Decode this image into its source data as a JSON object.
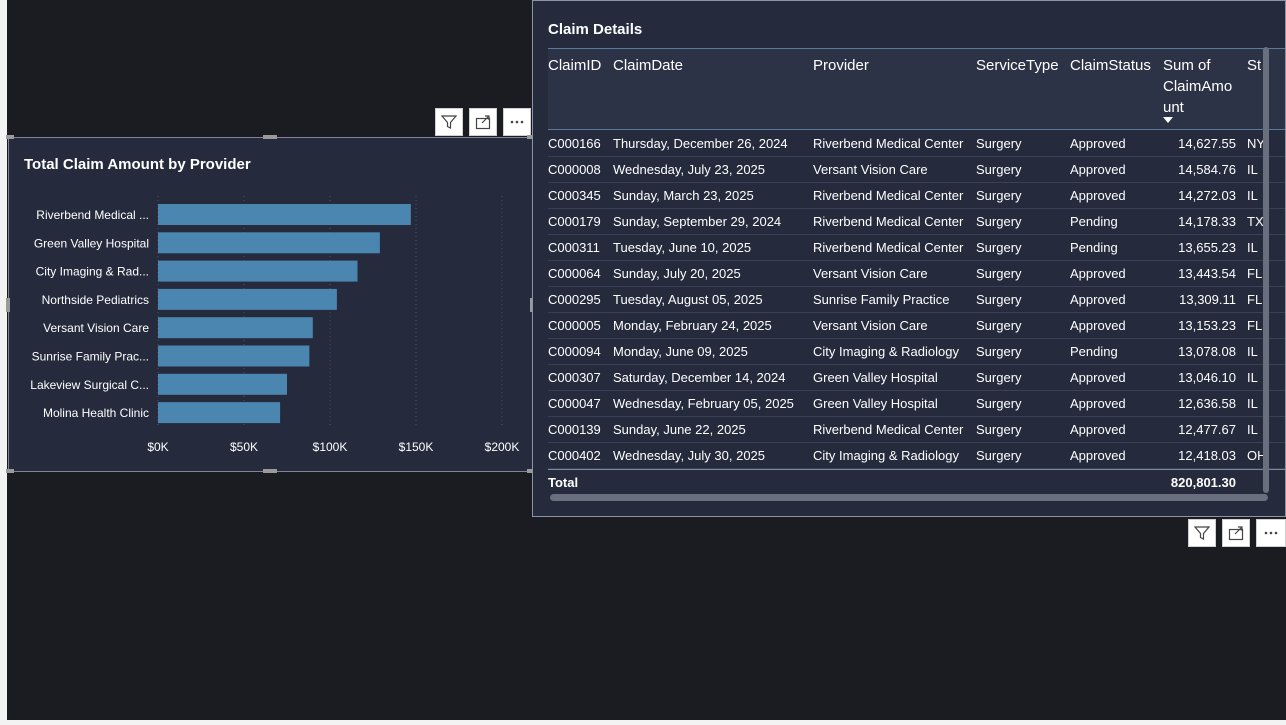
{
  "chart_visual": {
    "title": "Total Claim Amount by Provider",
    "buttons": [
      {
        "name": "filter-icon",
        "glyph": "⛉"
      },
      {
        "name": "focus-mode-icon",
        "glyph": "⤢"
      },
      {
        "name": "more-options-icon",
        "glyph": "⋯"
      }
    ]
  },
  "chart_data": {
    "type": "bar",
    "orientation": "horizontal",
    "title": "Total Claim Amount by Provider",
    "categories": [
      "Riverbend Medical ...",
      "Green Valley Hospital",
      "City Imaging & Rad...",
      "Northside Pediatrics",
      "Versant Vision Care",
      "Sunrise Family Prac...",
      "Lakeview Surgical C...",
      "Molina Health Clinic"
    ],
    "values": [
      147000,
      129000,
      116000,
      104000,
      90000,
      88000,
      75000,
      71000
    ],
    "xlim": [
      0,
      200000
    ],
    "xticks": [
      "$0K",
      "$50K",
      "$100K",
      "$150K",
      "$200K"
    ],
    "xtick_values": [
      0,
      50000,
      100000,
      150000,
      200000
    ],
    "grid": true,
    "bar_color": "#4a86b0"
  },
  "table_visual": {
    "title": "Claim Details",
    "columns": [
      "ClaimID",
      "ClaimDate",
      "Provider",
      "ServiceType",
      "ClaimStatus",
      "Sum of ClaimAmo unt",
      "St"
    ],
    "sum_header_lines": [
      "Sum of",
      "ClaimAmo",
      "unt"
    ],
    "rows": [
      [
        "C000166",
        "Thursday, December 26, 2024",
        "Riverbend Medical Center",
        "Surgery",
        "Approved",
        "14,627.55",
        "NY"
      ],
      [
        "C000008",
        "Wednesday, July 23, 2025",
        "Versant Vision Care",
        "Surgery",
        "Approved",
        "14,584.76",
        "IL"
      ],
      [
        "C000345",
        "Sunday, March 23, 2025",
        "Riverbend Medical Center",
        "Surgery",
        "Approved",
        "14,272.03",
        "IL"
      ],
      [
        "C000179",
        "Sunday, September 29, 2024",
        "Riverbend Medical Center",
        "Surgery",
        "Pending",
        "14,178.33",
        "TX"
      ],
      [
        "C000311",
        "Tuesday, June 10, 2025",
        "Riverbend Medical Center",
        "Surgery",
        "Pending",
        "13,655.23",
        "IL"
      ],
      [
        "C000064",
        "Sunday, July 20, 2025",
        "Versant Vision Care",
        "Surgery",
        "Approved",
        "13,443.54",
        "FL"
      ],
      [
        "C000295",
        "Tuesday, August 05, 2025",
        "Sunrise Family Practice",
        "Surgery",
        "Approved",
        "13,309.11",
        "FL"
      ],
      [
        "C000005",
        "Monday, February 24, 2025",
        "Versant Vision Care",
        "Surgery",
        "Approved",
        "13,153.23",
        "FL"
      ],
      [
        "C000094",
        "Monday, June 09, 2025",
        "City Imaging & Radiology",
        "Surgery",
        "Pending",
        "13,078.08",
        "IL"
      ],
      [
        "C000307",
        "Saturday, December 14, 2024",
        "Green Valley Hospital",
        "Surgery",
        "Approved",
        "13,046.10",
        "IL"
      ],
      [
        "C000047",
        "Wednesday, February 05, 2025",
        "Green Valley Hospital",
        "Surgery",
        "Approved",
        "12,636.58",
        "IL"
      ],
      [
        "C000139",
        "Sunday, June 22, 2025",
        "Riverbend Medical Center",
        "Surgery",
        "Approved",
        "12,477.67",
        "IL"
      ],
      [
        "C000402",
        "Wednesday, July 30, 2025",
        "City Imaging & Radiology",
        "Surgery",
        "Approved",
        "12,418.03",
        "OH"
      ]
    ],
    "total_label": "Total",
    "total_value": "820,801.30",
    "buttons": [
      {
        "name": "filter-icon",
        "glyph": "⛉"
      },
      {
        "name": "focus-mode-icon",
        "glyph": "⤢"
      },
      {
        "name": "more-options-icon",
        "glyph": "⋯"
      }
    ]
  }
}
